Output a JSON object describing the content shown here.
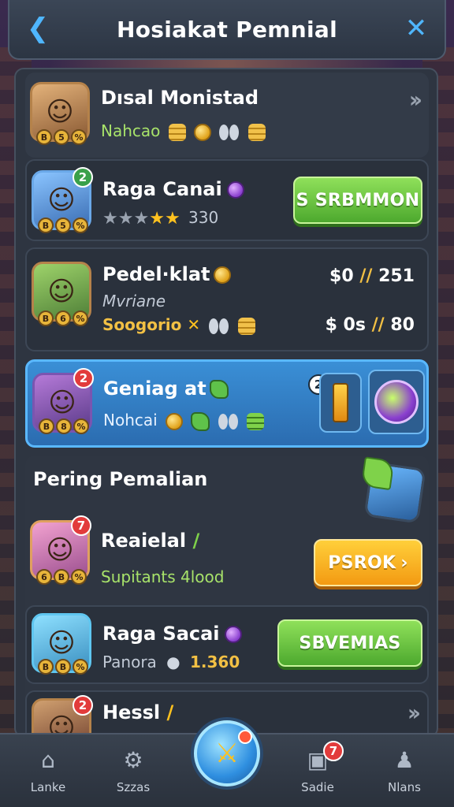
{
  "header": {
    "title": "Hosiakat Pemnial",
    "back_icon": "❮",
    "close_icon": "✕"
  },
  "rows": [
    {
      "name": "Dısal Monistad",
      "sub": "Nahcao",
      "badge": null
    },
    {
      "name": "Raga Canai",
      "stars_filled": 2,
      "stars_total": 5,
      "score": "330",
      "button": "S SRBMMON",
      "badge": "2"
    },
    {
      "name": "Pedel·klat",
      "sub1": "Mvriane",
      "sub2": "Soogorio",
      "price1_a": "$0",
      "price1_b": "251",
      "price2_a": "$ 0s",
      "price2_b": "80"
    },
    {
      "name": "Geniag at",
      "sub": "Nohcai",
      "badge": "2",
      "slot_badge": "2"
    }
  ],
  "section": {
    "title": "Pering Pemalian"
  },
  "section_rows": [
    {
      "name": "Reaielal",
      "sub": "Supitants 4lood",
      "badge": "7",
      "button": "PSROK"
    },
    {
      "name": "Raga Sacai",
      "sub_a": "Panora",
      "sub_b": "1.360",
      "button": "SBVEMIAS"
    },
    {
      "name": "Hessl",
      "badge": "2"
    }
  ],
  "nav": [
    {
      "label": "Lanke",
      "icon": "home-icon"
    },
    {
      "label": "Szzas",
      "icon": "helmet-icon"
    },
    {
      "label": "Sadie",
      "icon": "camera-icon",
      "badge": "7"
    },
    {
      "label": "Nlans",
      "icon": "person-icon"
    }
  ],
  "colors": {
    "accent": "#4fb6ff",
    "green_button": "#4da92e",
    "orange_button": "#f39a12",
    "selected_row": "#2b6cb0",
    "badge_red": "#e23b3b"
  }
}
